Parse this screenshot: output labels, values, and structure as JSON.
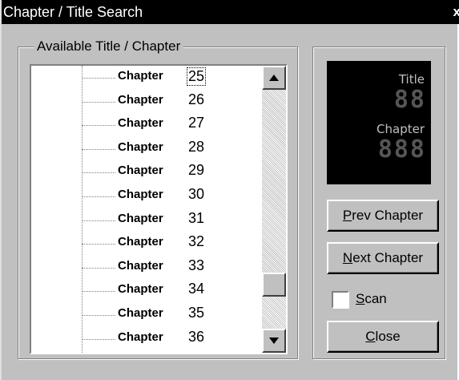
{
  "window": {
    "title": "Chapter / Title Search",
    "close_glyph": "x"
  },
  "group": {
    "label": "Available Title / Chapter"
  },
  "list": {
    "selected_index": 0,
    "items": [
      {
        "label": "Chapter",
        "num": "25"
      },
      {
        "label": "Chapter",
        "num": "26"
      },
      {
        "label": "Chapter",
        "num": "27"
      },
      {
        "label": "Chapter",
        "num": "28"
      },
      {
        "label": "Chapter",
        "num": "29"
      },
      {
        "label": "Chapter",
        "num": "30"
      },
      {
        "label": "Chapter",
        "num": "31"
      },
      {
        "label": "Chapter",
        "num": "32"
      },
      {
        "label": "Chapter",
        "num": "33"
      },
      {
        "label": "Chapter",
        "num": "34"
      },
      {
        "label": "Chapter",
        "num": "35"
      },
      {
        "label": "Chapter",
        "num": "36"
      }
    ]
  },
  "display": {
    "title_label": "Title",
    "title_value": "88",
    "chapter_label": "Chapter",
    "chapter_value": "888"
  },
  "buttons": {
    "prev_chapter": {
      "mnemonic": "P",
      "rest": "rev Chapter"
    },
    "next_chapter": {
      "mnemonic": "N",
      "rest": "ext Chapter"
    },
    "close": {
      "mnemonic": "C",
      "rest": "lose"
    }
  },
  "scan": {
    "mnemonic": "S",
    "rest": "can",
    "checked": false
  },
  "colors": {
    "titlebar": "#000000",
    "face": "#c0c0c0",
    "display_bg": "#000000"
  }
}
